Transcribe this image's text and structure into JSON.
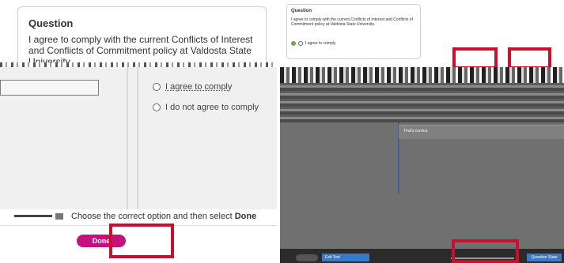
{
  "left_panel": {
    "question_heading": "Question",
    "question_text": "I agree to comply with the current Conflicts of Interest and Conflicts of Commitment policy at Valdosta State University.",
    "options": [
      {
        "label": "I agree to comply"
      },
      {
        "label": "I do not agree to comply"
      }
    ],
    "instruction_prefix": "Choose the correct option and then select ",
    "instruction_bold": "Done",
    "done_label": "Done"
  },
  "right_panel": {
    "question_heading": "Question",
    "question_text": "I agree to comply with the current Conflicts of Interest and Conflicts of Commitment policy at Valdosta State University.",
    "selected_option": "I agree to comply",
    "feedback_text": "That's correct.",
    "exit_label": "Exit Test",
    "question_state_label": "Question State"
  },
  "colors": {
    "highlight": "#c8102e",
    "done_button": "#c2127e",
    "player_button": "#3a79c4",
    "correct_check": "#6aa84f"
  }
}
